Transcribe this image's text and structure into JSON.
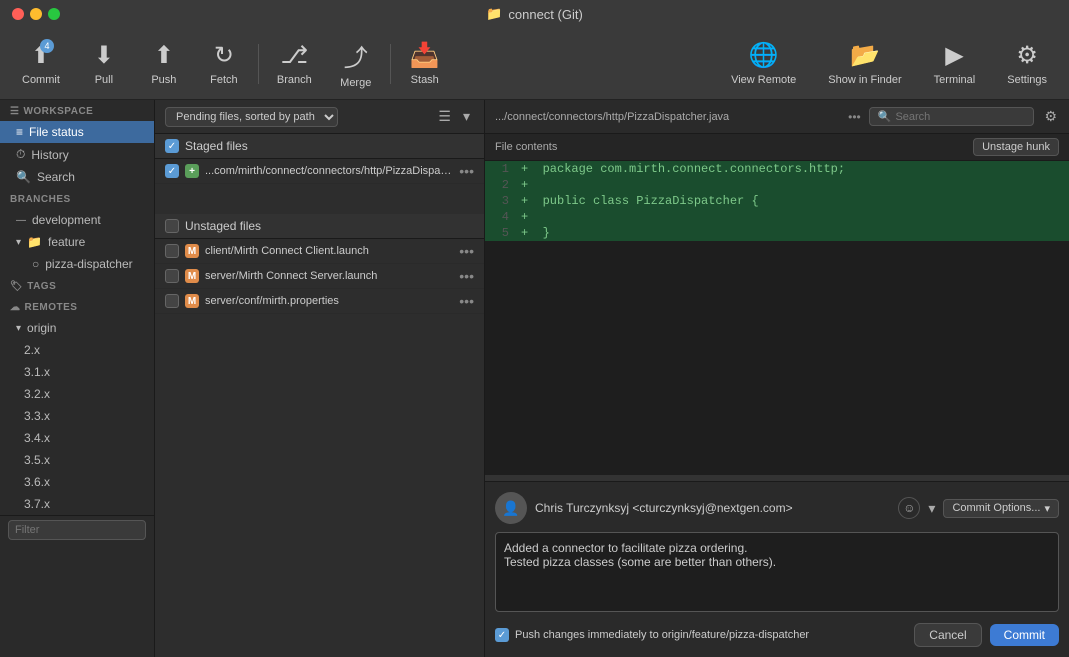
{
  "window": {
    "title": "connect (Git)"
  },
  "toolbar": {
    "commit_label": "Commit",
    "commit_badge": "4",
    "pull_label": "Pull",
    "push_label": "Push",
    "fetch_label": "Fetch",
    "branch_label": "Branch",
    "merge_label": "Merge",
    "stash_label": "Stash",
    "view_remote_label": "View Remote",
    "show_in_finder_label": "Show in Finder",
    "terminal_label": "Terminal",
    "settings_label": "Settings"
  },
  "sidebar": {
    "workspace_header": "WORKSPACE",
    "file_status_label": "File status",
    "history_label": "History",
    "search_label": "Search",
    "branches_header": "BRANCHES",
    "branch_development": "development",
    "branch_feature": "feature",
    "branch_pizza_dispatcher": "pizza-dispatcher",
    "tags_header": "TAGS",
    "remotes_header": "REMOTES",
    "remote_origin": "origin",
    "remote_branches": [
      "2.x",
      "3.1.x",
      "3.2.x",
      "3.3.x",
      "3.4.x",
      "3.5.x",
      "3.6.x",
      "3.7.x"
    ],
    "filter_placeholder": "Filter"
  },
  "file_panel": {
    "sort_label": "Pending files, sorted by path",
    "staged_header": "Staged files",
    "staged_file": "...com/mirth/connect/connectors/http/PizzaDispatcher.java",
    "unstaged_header": "Unstaged files",
    "unstaged_files": [
      "client/Mirth Connect Client.launch",
      "server/Mirth Connect Server.launch",
      "server/conf/mirth.properties"
    ]
  },
  "diff_panel": {
    "filepath": ".../connect/connectors/http/PizzaDispatcher.java",
    "file_label": "File contents",
    "unstage_btn": "Unstage hunk",
    "lines": [
      {
        "num": "1",
        "content": "  package com.mirth.connect.connectors.http;",
        "type": "added"
      },
      {
        "num": "2",
        "content": "",
        "type": "added"
      },
      {
        "num": "3",
        "content": "  public class PizzaDispatcher {",
        "type": "added"
      },
      {
        "num": "4",
        "content": "",
        "type": "added"
      },
      {
        "num": "5",
        "content": "  }",
        "type": "added"
      }
    ]
  },
  "commit_area": {
    "author": "Chris Turczynksyj <cturczynksyj@nextgen.com>",
    "message": "Added a connector to facilitate pizza ordering.\nTested pizza classes (some are better than others).",
    "push_label": "Push changes immediately to origin/feature/pizza-dispatcher",
    "cancel_label": "Cancel",
    "commit_label": "Commit",
    "commit_options_label": "Commit Options..."
  }
}
